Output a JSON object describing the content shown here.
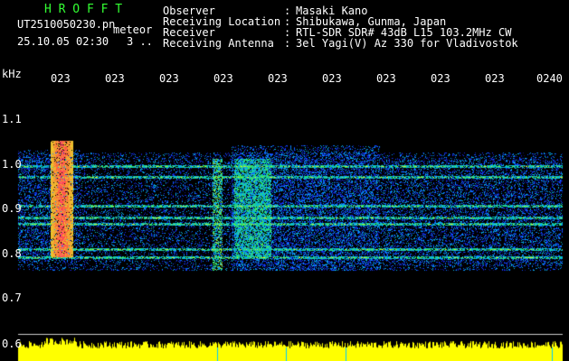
{
  "app": {
    "brand": "H R O F F T"
  },
  "file": {
    "name": "UT2510050230.pn",
    "meteor_label": "meteor",
    "datetime": "25.10.05 02:30",
    "count": "3 .."
  },
  "info": {
    "rows": [
      {
        "label": "Observer",
        "sep": ":",
        "value": "Masaki Kano"
      },
      {
        "label": "Receiving Location",
        "sep": ":",
        "value": "Shibukawa, Gunma, Japan"
      },
      {
        "label": "Receiver",
        "sep": ":",
        "value": "RTL-SDR SDR# 43dB L15 103.2MHz CW"
      },
      {
        "label": "Receiving Antenna",
        "sep": ":",
        "value": "3el Yagi(V) Az 330 for Vladivostok"
      }
    ]
  },
  "axis": {
    "y_unit": "kHz",
    "y_ticks": [
      "1.1",
      "1.0",
      "0.9",
      "0.8",
      "0.7",
      "0.6"
    ],
    "x_ticks": [
      "023",
      "023",
      "023",
      "023",
      "023",
      "023",
      "023",
      "023",
      "023",
      "0240"
    ]
  },
  "colors": {
    "text": "#ffffff",
    "brand": "#33ff33",
    "background": "#000000",
    "floor": "#1a2cff",
    "level": "#ffff00",
    "marker": "#00ccff"
  }
}
